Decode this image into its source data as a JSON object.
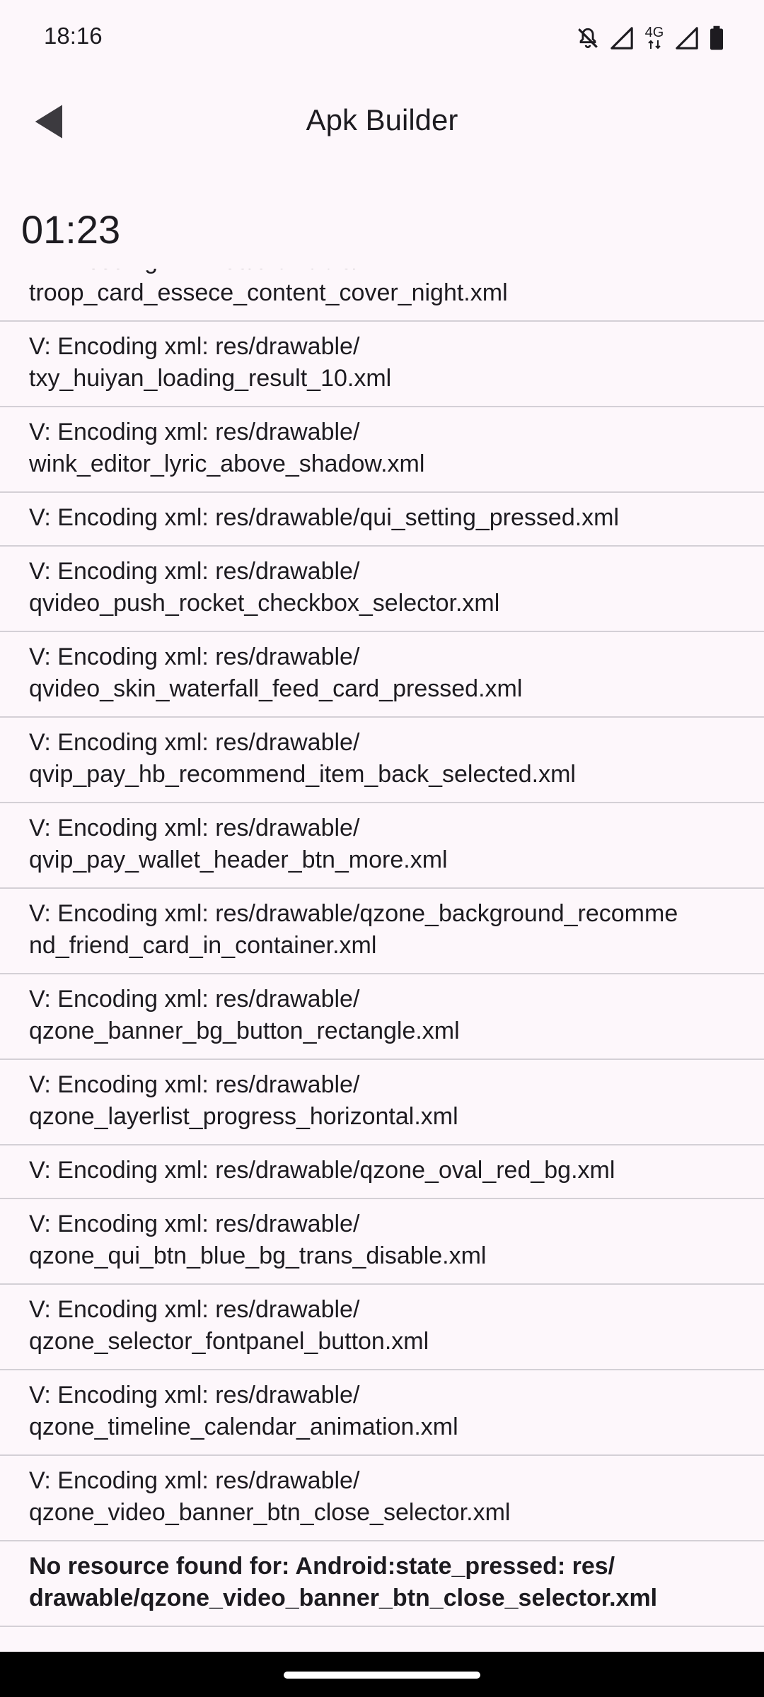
{
  "status_bar": {
    "time": "18:16",
    "network_label": "4G",
    "icons": [
      "notifications-off-icon",
      "signal-icon",
      "4g-data-icon",
      "signal-icon",
      "battery-icon"
    ]
  },
  "app_bar": {
    "title": "Apk Builder",
    "back_icon": "back-arrow-icon"
  },
  "timer": "01:23",
  "log": [
    {
      "text": "V: Encoding xml: res/drawable/\ntroop_card_essece_content_cover_night.xml",
      "bold": false
    },
    {
      "text": "V: Encoding xml: res/drawable/\ntxy_huiyan_loading_result_10.xml",
      "bold": false
    },
    {
      "text": "V: Encoding xml: res/drawable/\nwink_editor_lyric_above_shadow.xml",
      "bold": false
    },
    {
      "text": "V: Encoding xml: res/drawable/qui_setting_pressed.xml",
      "bold": false
    },
    {
      "text": "V: Encoding xml: res/drawable/\nqvideo_push_rocket_checkbox_selector.xml",
      "bold": false
    },
    {
      "text": "V: Encoding xml: res/drawable/\nqvideo_skin_waterfall_feed_card_pressed.xml",
      "bold": false
    },
    {
      "text": "V: Encoding xml: res/drawable/\nqvip_pay_hb_recommend_item_back_selected.xml",
      "bold": false
    },
    {
      "text": "V: Encoding xml: res/drawable/\nqvip_pay_wallet_header_btn_more.xml",
      "bold": false
    },
    {
      "text": "V: Encoding xml: res/drawable/qzone_background_recomme\nnd_friend_card_in_container.xml",
      "bold": false
    },
    {
      "text": "V: Encoding xml: res/drawable/\nqzone_banner_bg_button_rectangle.xml",
      "bold": false
    },
    {
      "text": "V: Encoding xml: res/drawable/\nqzone_layerlist_progress_horizontal.xml",
      "bold": false
    },
    {
      "text": "V: Encoding xml: res/drawable/qzone_oval_red_bg.xml",
      "bold": false
    },
    {
      "text": "V: Encoding xml: res/drawable/\nqzone_qui_btn_blue_bg_trans_disable.xml",
      "bold": false
    },
    {
      "text": "V: Encoding xml: res/drawable/\nqzone_selector_fontpanel_button.xml",
      "bold": false
    },
    {
      "text": "V: Encoding xml: res/drawable/\nqzone_timeline_calendar_animation.xml",
      "bold": false
    },
    {
      "text": "V: Encoding xml: res/drawable/\nqzone_video_banner_btn_close_selector.xml",
      "bold": false
    },
    {
      "text": "No resource found for: Android:state_pressed: res/\ndrawable/qzone_video_banner_btn_close_selector.xml",
      "bold": true
    }
  ]
}
